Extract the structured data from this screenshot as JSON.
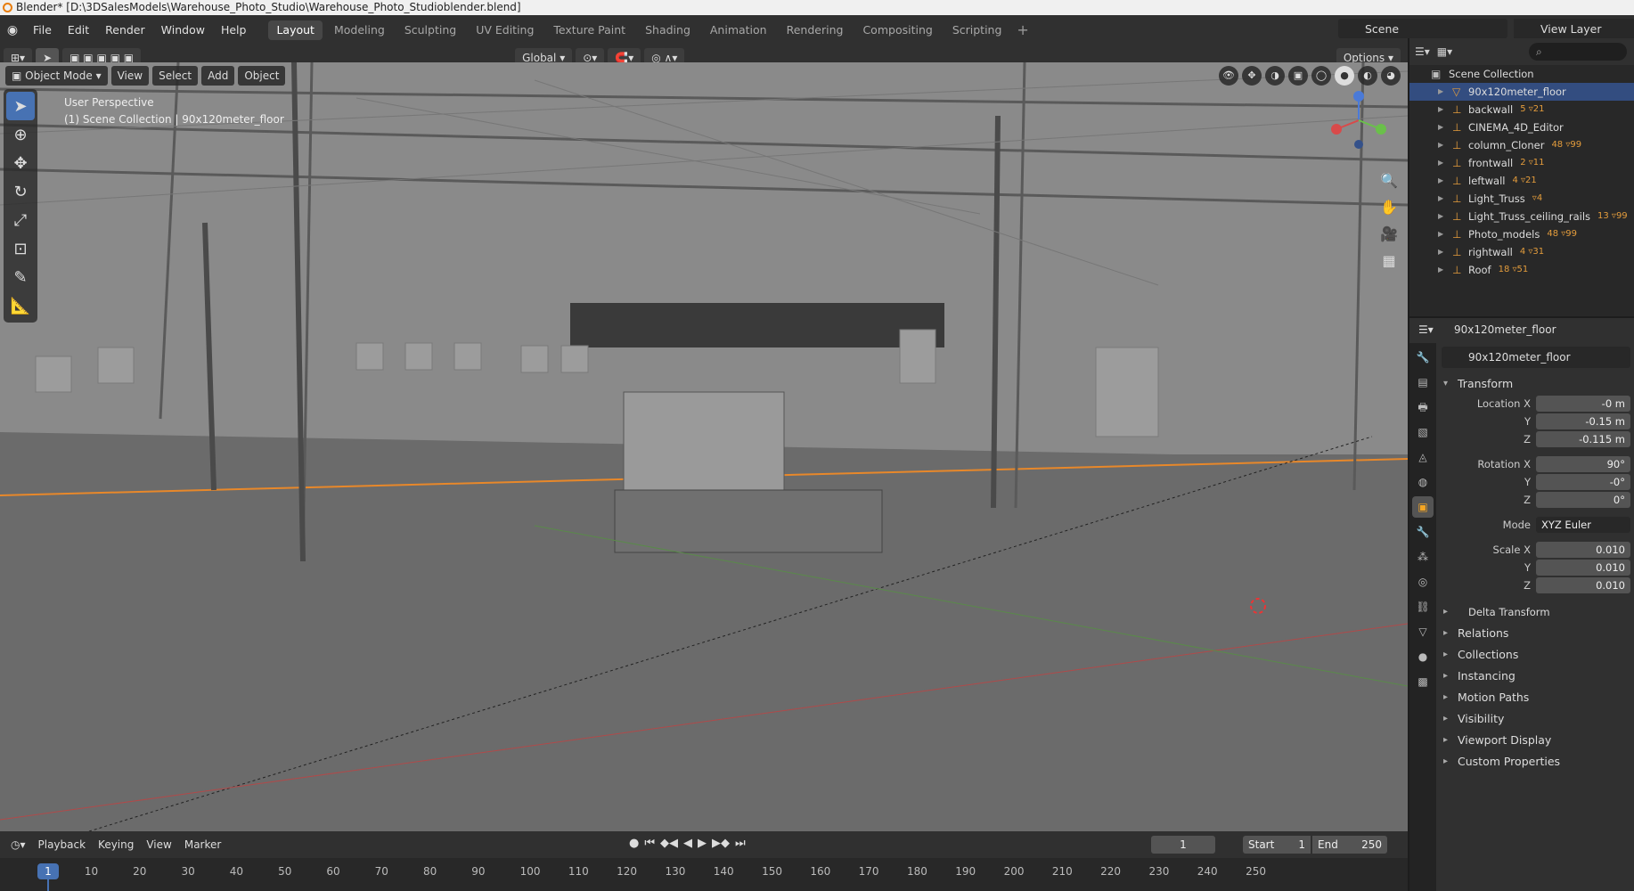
{
  "window_title": "Blender* [D:\\3DSalesModels\\Warehouse_Photo_Studio\\Warehouse_Photo_Studioblender.blend]",
  "menus": [
    "File",
    "Edit",
    "Render",
    "Window",
    "Help"
  ],
  "workspaces": [
    "Layout",
    "Modeling",
    "Sculpting",
    "UV Editing",
    "Texture Paint",
    "Shading",
    "Animation",
    "Rendering",
    "Compositing",
    "Scripting"
  ],
  "active_workspace": "Layout",
  "scene": "Scene",
  "view_layer": "View Layer",
  "header": {
    "orientation": "Global",
    "options": "Options"
  },
  "viewport": {
    "mode": "Object Mode",
    "menu": [
      "View",
      "Select",
      "Add",
      "Object"
    ],
    "info_line1": "User Perspective",
    "info_line2": "(1) Scene Collection | 90x120meter_floor"
  },
  "outliner": {
    "root": "Scene Collection",
    "items": [
      {
        "name": "90x120meter_floor",
        "mods": "",
        "selected": true
      },
      {
        "name": "backwall",
        "mods": "5 ▿21"
      },
      {
        "name": "CINEMA_4D_Editor",
        "mods": ""
      },
      {
        "name": "column_Cloner",
        "mods": "48 ▿99"
      },
      {
        "name": "frontwall",
        "mods": "2 ▿11"
      },
      {
        "name": "leftwall",
        "mods": "4 ▿21"
      },
      {
        "name": "Light_Truss",
        "mods": "▿4"
      },
      {
        "name": "Light_Truss_ceiling_rails",
        "mods": "13 ▿99"
      },
      {
        "name": "Photo_models",
        "mods": "48 ▿99"
      },
      {
        "name": "rightwall",
        "mods": "4 ▿31"
      },
      {
        "name": "Roof",
        "mods": "18 ▿51"
      }
    ]
  },
  "properties": {
    "header_object": "90x120meter_floor",
    "object_name": "90x120meter_floor",
    "transform_label": "Transform",
    "location": {
      "label": "Location X",
      "x": "-0 m",
      "y": "-0.15 m",
      "z": "-0.115 m"
    },
    "rotation": {
      "label": "Rotation X",
      "x": "90°",
      "y": "-0°",
      "z": "0°"
    },
    "mode_label": "Mode",
    "mode_value": "XYZ Euler",
    "scale": {
      "label": "Scale X",
      "x": "0.010",
      "y": "0.010",
      "z": "0.010"
    },
    "axis_y": "Y",
    "axis_z": "Z",
    "delta": "Delta Transform",
    "panels": [
      "Relations",
      "Collections",
      "Instancing",
      "Motion Paths",
      "Visibility",
      "Viewport Display",
      "Custom Properties"
    ]
  },
  "timeline": {
    "menu": [
      "Playback",
      "Keying",
      "View",
      "Marker"
    ],
    "current_frame": "1",
    "start_label": "Start",
    "start": "1",
    "end_label": "End",
    "end": "250",
    "ticks": [
      "10",
      "20",
      "30",
      "40",
      "50",
      "60",
      "70",
      "80",
      "90",
      "100",
      "110",
      "120",
      "130",
      "140",
      "150",
      "160",
      "170",
      "180",
      "190",
      "200",
      "210",
      "220",
      "230",
      "240",
      "250"
    ]
  }
}
